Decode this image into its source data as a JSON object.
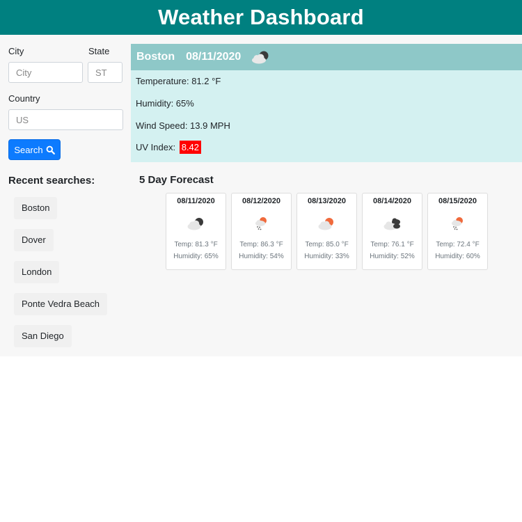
{
  "header": {
    "title": "Weather Dashboard"
  },
  "form": {
    "city_label": "City",
    "city_placeholder": "City",
    "state_label": "State",
    "state_placeholder": "ST",
    "country_label": "Country",
    "country_placeholder": "US",
    "search_label": "Search"
  },
  "recent": {
    "title": "Recent searches:",
    "items": [
      "Boston",
      "Dover",
      "London",
      "Ponte Vedra Beach",
      "San Diego"
    ]
  },
  "current": {
    "city": "Boston",
    "date": "08/11/2020",
    "icon": "night-cloudy-icon",
    "temperature": "Temperature: 81.2 °F",
    "humidity": "Humidity: 65%",
    "wind": "Wind Speed: 13.9 MPH",
    "uv_label": "UV Index:",
    "uv_value": "8.42",
    "uv_color": "#ff0000"
  },
  "forecast": {
    "title": "5 Day Forecast",
    "days": [
      {
        "date": "08/11/2020",
        "icon": "night-cloudy-icon",
        "temp": "Temp: 81.3 °F",
        "humidity": "Humidity: 65%"
      },
      {
        "date": "08/12/2020",
        "icon": "rain-sun-icon",
        "temp": "Temp: 86.3 °F",
        "humidity": "Humidity: 54%"
      },
      {
        "date": "08/13/2020",
        "icon": "sun-cloud-icon",
        "temp": "Temp: 85.0 °F",
        "humidity": "Humidity: 33%"
      },
      {
        "date": "08/14/2020",
        "icon": "dark-clouds-icon",
        "temp": "Temp: 76.1 °F",
        "humidity": "Humidity: 52%"
      },
      {
        "date": "08/15/2020",
        "icon": "rain-sun-icon",
        "temp": "Temp: 72.4 °F",
        "humidity": "Humidity: 60%"
      }
    ]
  },
  "colors": {
    "header": "#008080",
    "current_head": "#8ec8c8",
    "current_body": "#d4f1f1",
    "button": "#0d7bfe"
  }
}
